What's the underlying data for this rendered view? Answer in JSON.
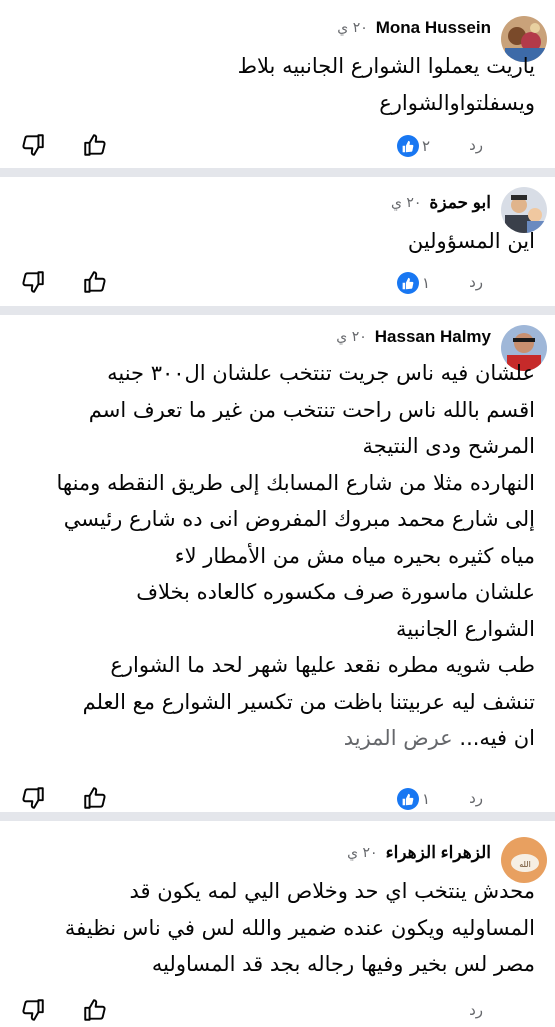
{
  "comments": [
    {
      "author": "Mona Hussein",
      "time": "٢٠ ي",
      "body": "ياريت يعملوا الشوارع الجانبيه  بلاط\nويسفلتواوالشوارع",
      "reply": "رد",
      "reactions": "٢",
      "avatar": "avatar-photo-mona"
    },
    {
      "author": "ابو حمزة",
      "time": "٢٠ ي",
      "body": "اين المسؤولين",
      "reply": "رد",
      "reactions": "١",
      "avatar": "avatar-photo-abu-hamza"
    },
    {
      "author": "Hassan Halmy",
      "time": "٢٠ ي",
      "body": "علشان فيه ناس جريت تنتخب علشان ال٣٠٠ جنيه\nاقسم بالله ناس راحت تنتخب من غير ما تعرف اسم\nالمرشح ودى النتيجة\nالنهارده مثلا من شارع المسابك إلى طريق النقطه ومنها\nإلى شارع محمد مبروك المفروض انى ده شارع رئيسي\nمياه كثيره بحيره مياه مش من الأمطار لاء\nعلشان ماسورة صرف مكسوره كالعاده  بخلاف\nالشوارع الجانبية\nطب شويه مطره نقعد عليها شهر لحد ما الشوارع\nتنشف ليه عربيتنا باظت من تكسير الشوارع مع العلم\nان فيه...",
      "see_more": "عرض المزيد",
      "reply": "رد",
      "reactions": "١",
      "avatar": "avatar-photo-hassan"
    },
    {
      "author": "الزهراء الزهراء",
      "time": "٢٠ ي",
      "body": "محدش ينتخب اي حد وخلاص اليي لمه يكون قد\nالمساوليه ويكون عنده ضمير والله لس في ناس نظيفة\nمصر لس بخير وفيها رجاله بجد قد المساوليه",
      "reply": "رد",
      "reactions": "",
      "avatar": "avatar-photo-alzahraa"
    }
  ],
  "colors": {
    "like_blue": "#1877f2",
    "meta_gray": "#65676b",
    "separator": "#e4e6eb"
  }
}
